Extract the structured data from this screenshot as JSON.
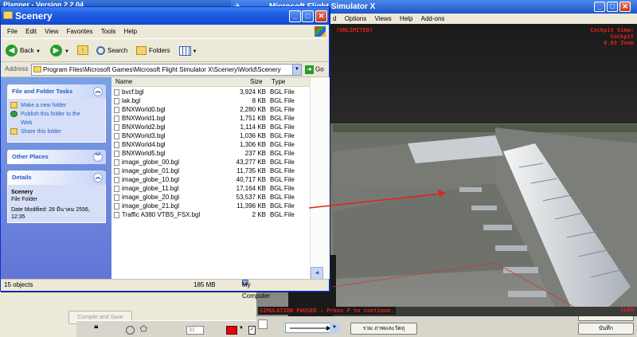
{
  "flight_planner": {
    "title": "Planner - Version 2.2.04",
    "compile_button": "Compile and Save",
    "quote_glyph": "66",
    "status_field": "31"
  },
  "fsx": {
    "title": "Microsoft Flight Simulator X",
    "menu": [
      "d",
      "Options",
      "Views",
      "Help",
      "Add-ons"
    ],
    "hud_left": "(UNLIMITED)",
    "hud_right": [
      "Cockpit View:",
      "Cockpit",
      "0.69 Zoom"
    ],
    "paused": "SIMULATION PAUSED - Press P to continue.",
    "slew": "SLEW",
    "thai_button_1": "รวม ภาพและวัตถุ",
    "thai_button_2": "บันทึก"
  },
  "explorer": {
    "title": "Scenery",
    "menu": [
      "File",
      "Edit",
      "View",
      "Favorites",
      "Tools",
      "Help"
    ],
    "toolbar": {
      "back": "Back",
      "search": "Search",
      "folders": "Folders"
    },
    "address_label": "Address",
    "address_value": "Program Files\\Microsoft Games\\Microsoft Flight Simulator X\\Scenery\\World\\Scenery",
    "go_label": "Go",
    "tasks": {
      "title": "File and Folder Tasks",
      "links": [
        "Make a new folder",
        "Publish this folder to the",
        "Web",
        "Share this folder"
      ]
    },
    "other_places": {
      "title": "Other Places"
    },
    "details": {
      "title": "Details",
      "name": "Scenery",
      "kind": "File Folder",
      "modified": "Date Modified: 28 มีนาคม 2556,",
      "time": "12:35"
    },
    "columns": {
      "name": "Name",
      "size": "Size",
      "type": "Type"
    },
    "files": [
      {
        "name": "bvcf.bgl",
        "size": "3,924 KB",
        "type": "BGL File"
      },
      {
        "name": "lak.bgl",
        "size": "8 KB",
        "type": "BGL File"
      },
      {
        "name": "BNXWorld0.bgl",
        "size": "2,280 KB",
        "type": "BGL File"
      },
      {
        "name": "BNXWorld1.bgl",
        "size": "1,751 KB",
        "type": "BGL File"
      },
      {
        "name": "BNXWorld2.bgl",
        "size": "1,114 KB",
        "type": "BGL File"
      },
      {
        "name": "BNXWorld3.bgl",
        "size": "1,036 KB",
        "type": "BGL File"
      },
      {
        "name": "BNXWorld4.bgl",
        "size": "1,306 KB",
        "type": "BGL File"
      },
      {
        "name": "BNXWorld5.bgl",
        "size": "237 KB",
        "type": "BGL File"
      },
      {
        "name": "image_globe_00.bgl",
        "size": "43,277 KB",
        "type": "BGL File"
      },
      {
        "name": "image_globe_01.bgl",
        "size": "11,735 KB",
        "type": "BGL File"
      },
      {
        "name": "image_globe_10.bgl",
        "size": "40,717 KB",
        "type": "BGL File"
      },
      {
        "name": "image_globe_11.bgl",
        "size": "17,164 KB",
        "type": "BGL File"
      },
      {
        "name": "image_globe_20.bgl",
        "size": "53,537 KB",
        "type": "BGL File"
      },
      {
        "name": "image_globe_21.bgl",
        "size": "11,396 KB",
        "type": "BGL File"
      },
      {
        "name": "Traffic A380 VTBS_FSX.bgl",
        "size": "2 KB",
        "type": "BGL File"
      }
    ],
    "status": {
      "objects": "15 objects",
      "size": "185 MB",
      "location": "My Computer"
    }
  },
  "colors": {
    "xp_blue": "#1e5ce0",
    "hud_red": "#e3221b",
    "task_pane": "#6f8fe0"
  }
}
